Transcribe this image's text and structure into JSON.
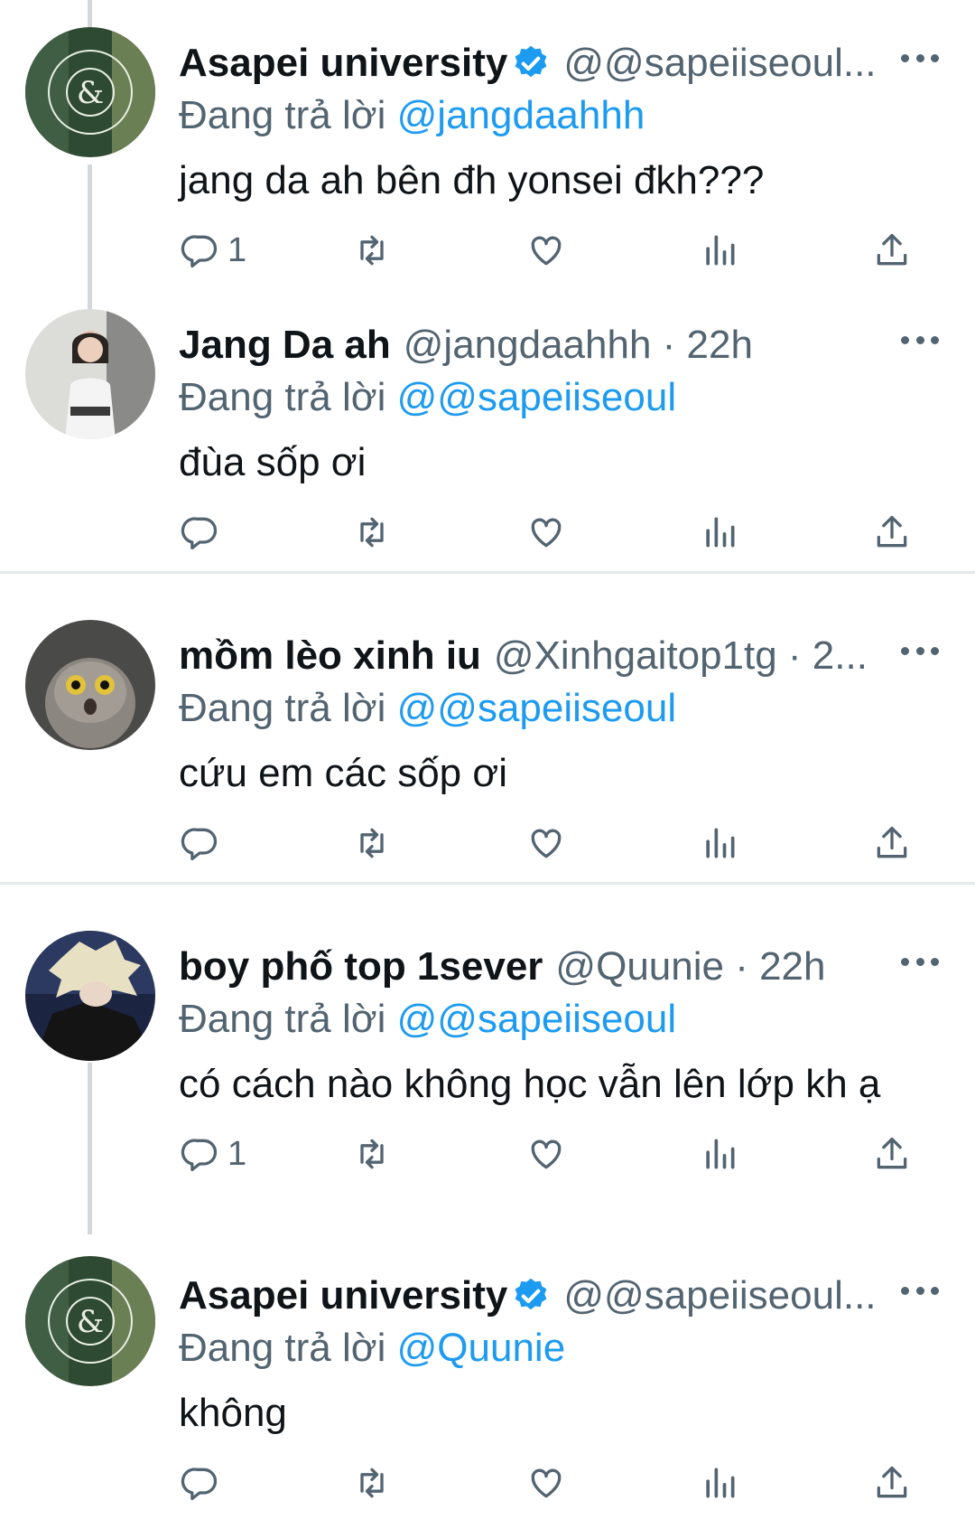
{
  "tweets": [
    {
      "name": "Asapei university",
      "verified": true,
      "handle": "@@sapeiiseoul...",
      "reply_prefix": "Đang trả lời",
      "reply_to": "@jangdaahhh",
      "text": "jang da ah bên đh yonsei đkh???",
      "reply_count": "1",
      "avatar": "school-logo"
    },
    {
      "name": "Jang Da ah",
      "verified": false,
      "handle": "@jangdaahhh · 22h",
      "reply_prefix": "Đang trả lời",
      "reply_to": "@@sapeiiseoul",
      "text": "đùa sốp ơi",
      "reply_count": "",
      "avatar": "girl-photo"
    },
    {
      "name": "mồm lèo xinh iu",
      "verified": false,
      "handle": "@Xinhgaitop1tg · 2...",
      "reply_prefix": "Đang trả lời",
      "reply_to": "@@sapeiiseoul",
      "text": "cứu em các sốp ơi",
      "reply_count": "",
      "avatar": "cat-photo"
    },
    {
      "name": "boy phố top 1sever",
      "verified": false,
      "handle": "@Quunie · 22h",
      "reply_prefix": "Đang trả lời",
      "reply_to": "@@sapeiiseoul",
      "text": "có cách nào không học vẫn lên lớp kh ạ",
      "reply_count": "1",
      "avatar": "anime-photo"
    },
    {
      "name": "Asapei university",
      "verified": true,
      "handle": "@@sapeiiseoul...",
      "reply_prefix": "Đang trả lời",
      "reply_to": "@Quunie",
      "text": "không",
      "reply_count": "",
      "avatar": "school-logo"
    }
  ],
  "colors": {
    "text": "#0f1419",
    "secondary": "#536471",
    "accent": "#1d9bf0",
    "separator": "#e6e9ec",
    "thread_line": "#d3d8dc"
  },
  "icons": [
    "reply-icon",
    "retweet-icon",
    "like-icon",
    "views-icon",
    "share-icon",
    "more-icon",
    "verified-icon"
  ]
}
